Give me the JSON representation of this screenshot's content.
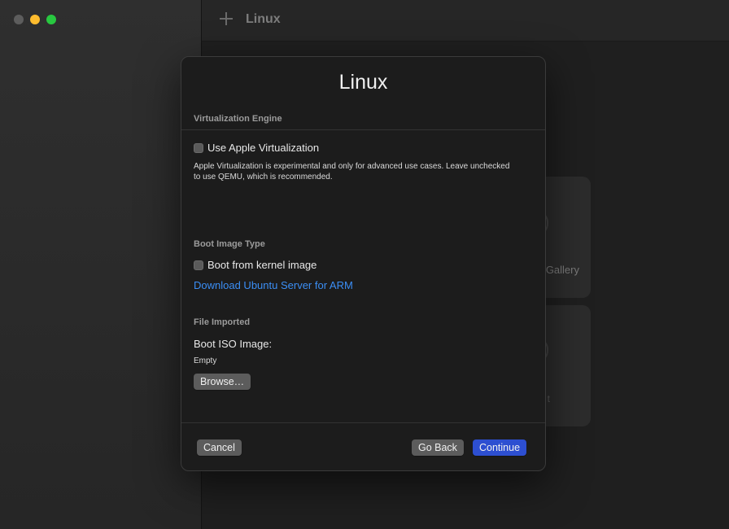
{
  "window": {
    "title": "Linux",
    "traffic_lights": [
      "close",
      "minimize",
      "zoom"
    ]
  },
  "background": {
    "card1_label": "Gallery",
    "card2_label": "t"
  },
  "dialog": {
    "title": "Linux",
    "virtualization": {
      "heading": "Virtualization Engine",
      "checkbox_label": "Use Apple Virtualization",
      "checked": false,
      "description": "Apple Virtualization is experimental and only for advanced use cases. Leave unchecked to use QEMU, which is recommended."
    },
    "boot": {
      "heading": "Boot Image Type",
      "checkbox_label": "Boot from kernel image",
      "checked": false,
      "link": "Download Ubuntu Server for ARM"
    },
    "file": {
      "heading": "File Imported",
      "label": "Boot ISO Image:",
      "value": "Empty",
      "browse_label": "Browse…"
    },
    "buttons": {
      "cancel": "Cancel",
      "back": "Go Back",
      "continue": "Continue"
    }
  },
  "colors": {
    "accent": "#2d4fd1",
    "link": "#3b8ef5"
  }
}
